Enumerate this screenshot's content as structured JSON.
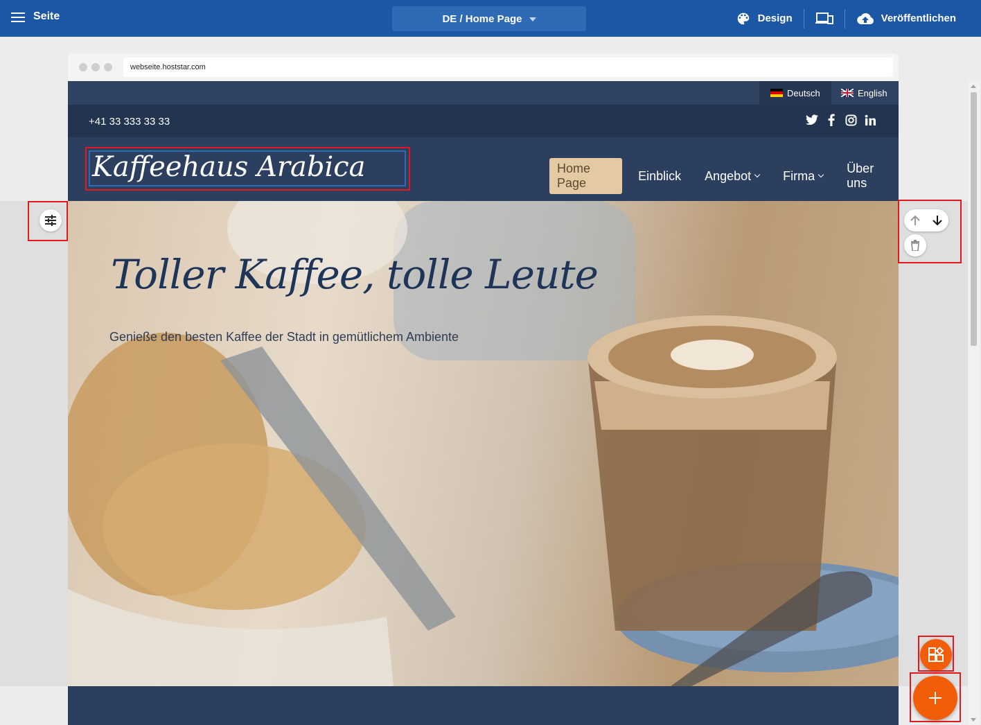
{
  "topbar": {
    "menu_label": "Seite",
    "page_selector": "DE / Home Page",
    "design_label": "Design",
    "publish_label": "Veröffentlichen"
  },
  "browser": {
    "url": "webseite.hoststar.com"
  },
  "site": {
    "languages": [
      "Deutsch",
      "English"
    ],
    "phone": "+41 33 333 33 33",
    "logo": "Kaffeehaus Arabica",
    "nav": {
      "home": "Home Page",
      "einblick": "Einblick",
      "angebot": "Angebot",
      "firma": "Firma",
      "ueber_uns": "Über uns"
    },
    "hero": {
      "title": "Toller Kaffee, tolle Leute",
      "subtitle": "Genieße den besten Kaffee der Stadt in gemütlichem Ambiente"
    }
  },
  "colors": {
    "toolbar": "#1c57a5",
    "site_header": "#2c3f5e",
    "active_nav": "#e3caa2",
    "fab": "#f25d0a",
    "highlight": "#e0191e"
  }
}
